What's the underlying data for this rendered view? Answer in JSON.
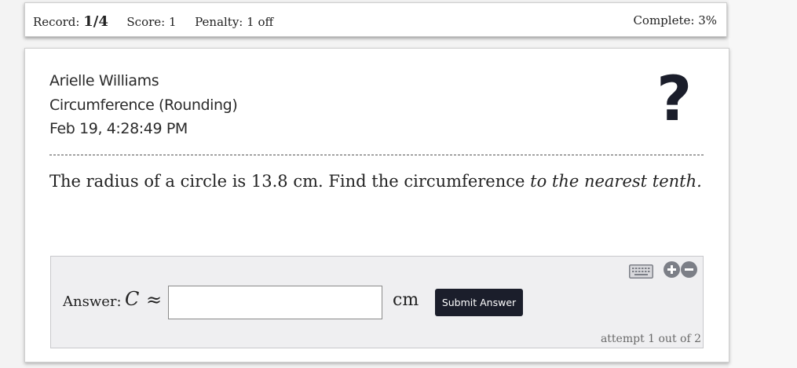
{
  "header": {
    "record_label": "Record:",
    "record_value": "1/4",
    "score_label": "Score:",
    "score_value": "1",
    "penalty_label": "Penalty:",
    "penalty_value": "1 off",
    "complete_label": "Complete:",
    "complete_value": "3%"
  },
  "info": {
    "student_name": "Arielle Williams",
    "topic": "Circumference (Rounding)",
    "timestamp": "Feb 19, 4:28:49 PM",
    "status_mark": "?"
  },
  "question": {
    "text": "The radius of a circle is 13.8 cm. Find the circumference",
    "emphasis": "to the nearest tenth."
  },
  "answer": {
    "label": "Answer:",
    "variable": "C",
    "relation": "≈",
    "value": "",
    "unit": "cm",
    "submit_label": "Submit Answer",
    "attempt_text": "attempt 1 out of 2"
  },
  "icons": {
    "keyboard": "keyboard-icon",
    "zoom_in": "plus-circle-icon",
    "zoom_out": "minus-circle-icon"
  },
  "colors": {
    "accent": "#1b1e2b",
    "answer_bg": "#efeff1"
  }
}
